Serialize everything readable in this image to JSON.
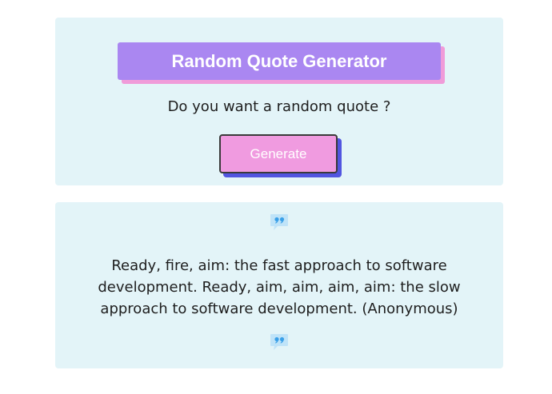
{
  "header": {
    "title": "Random Quote Generator",
    "prompt": "Do you want a random quote ?",
    "generate_label": "Generate"
  },
  "quote": {
    "text": "Ready, fire, aim: the fast approach to software development. Ready, aim, aim, aim, aim: the slow approach to software development. (Anonymous)",
    "icon_open": "quote-icon",
    "icon_close": "quote-icon"
  },
  "colors": {
    "card_bg": "#e3f4f8",
    "title_bg": "#aa87f1",
    "title_shadow": "#f09bd9",
    "button_bg": "#f09be0",
    "button_shadow": "#5155e0",
    "icon": "#3aa0e8"
  }
}
